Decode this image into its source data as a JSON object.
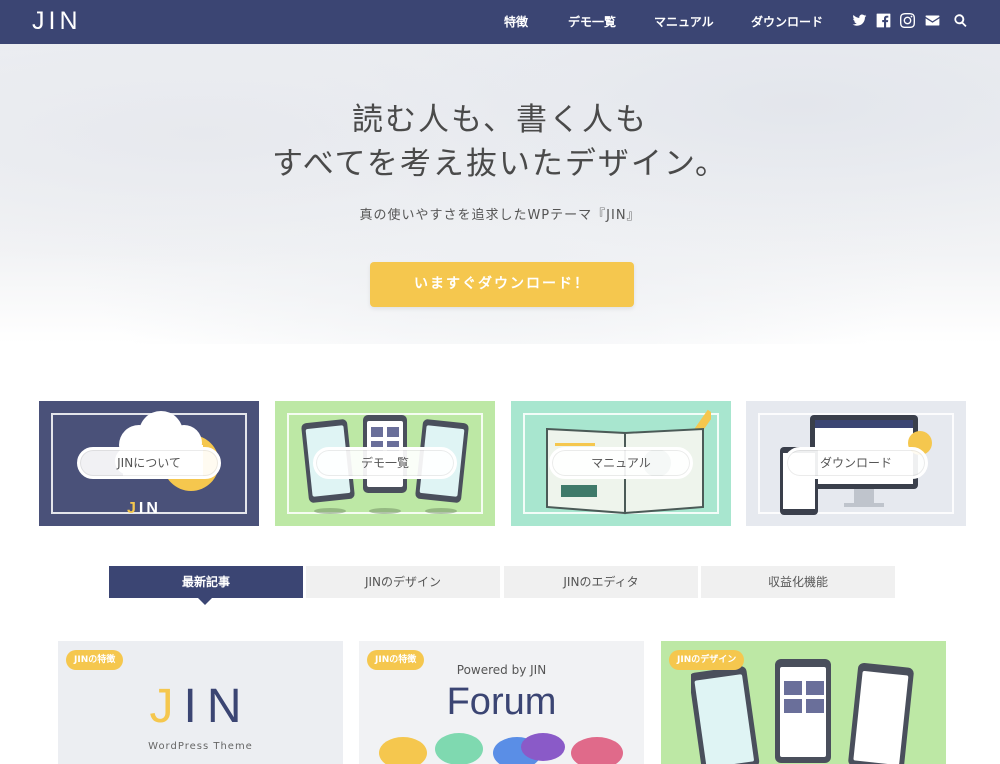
{
  "header": {
    "logo": "JIN",
    "nav": [
      "特徴",
      "デモ一覧",
      "マニュアル",
      "ダウンロード"
    ]
  },
  "hero": {
    "title_line1": "読む人も、書く人も",
    "title_line2": "すべてを考え抜いたデザイン。",
    "subtitle": "真の使いやすさを追求したWPテーマ『JIN』",
    "cta": "いますぐダウンロード！"
  },
  "cards": [
    {
      "label": "JINについて",
      "logo": "JIN"
    },
    {
      "label": "デモ一覧"
    },
    {
      "label": "マニュアル"
    },
    {
      "label": "ダウンロード"
    }
  ],
  "tabs": [
    "最新記事",
    "JINのデザイン",
    "JINのエディタ",
    "収益化機能"
  ],
  "posts": [
    {
      "badge": "JINの特徴",
      "logo": "JIN",
      "caption": "WordPress Theme"
    },
    {
      "badge": "JINの特徴",
      "powered": "Powered by JIN",
      "title": "Forum"
    },
    {
      "badge": "JINのデザイン"
    }
  ],
  "colors": {
    "navy": "#3b4573",
    "yellow": "#f5c74e",
    "green": "#bde8a5",
    "mint": "#a8e6cf"
  },
  "icons": [
    "twitter-icon",
    "facebook-icon",
    "instagram-icon",
    "mail-icon",
    "search-icon"
  ]
}
